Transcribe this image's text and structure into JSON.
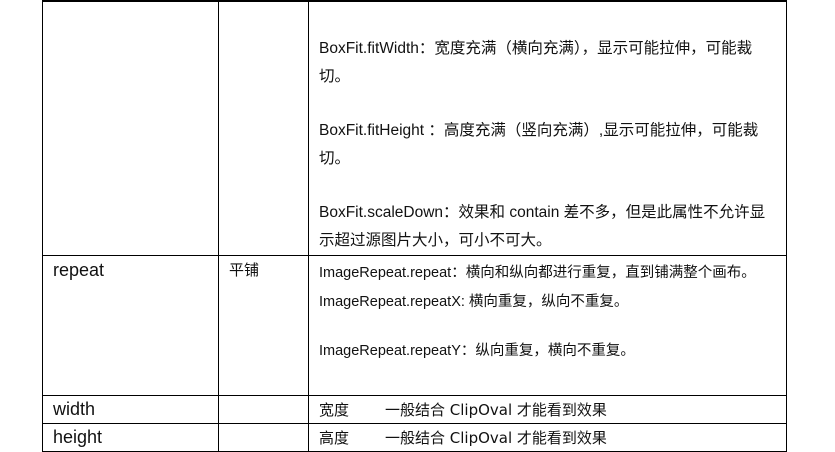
{
  "fit_rows": {
    "fit_width": "BoxFit.fitWidth：宽度充满（横向充满），显示可能拉伸，可能裁切。",
    "fit_height": "BoxFit.fitHeight ：高度充满（竖向充满）,显示可能拉伸，可能裁切。",
    "scale_down": "BoxFit.scaleDown：效果和 contain 差不多，但是此属性不允许显示超过源图片大小，可小不可大。"
  },
  "repeat_row": {
    "name": "repeat",
    "desc": "平铺",
    "repeat": "ImageRepeat.repeat：横向和纵向都进行重复，直到铺满整个画布。",
    "repeat_x": "ImageRepeat.repeatX: 横向重复，纵向不重复。",
    "repeat_y": "ImageRepeat.repeatY：纵向重复，横向不重复。"
  },
  "width_row": {
    "name": "width",
    "label": "宽度",
    "value": "一般结合 ClipOval 才能看到效果"
  },
  "height_row": {
    "name": "height",
    "label": "高度",
    "value": "一般结合 ClipOval 才能看到效果"
  }
}
